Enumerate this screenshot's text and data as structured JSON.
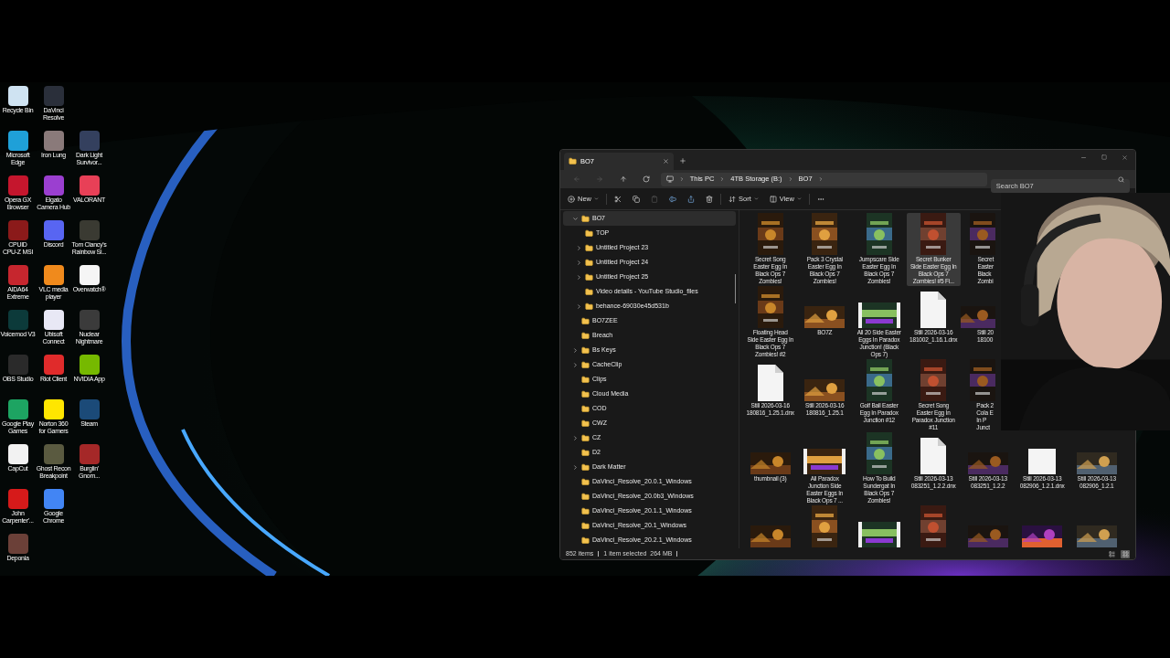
{
  "desktop_rows": [
    [
      {
        "label": "Recycle Bin",
        "color": "#cfe3f2"
      },
      {
        "label": "DaVinci\nResolve",
        "color": "#2a2f3a"
      }
    ],
    [
      {
        "label": "Microsoft\nEdge",
        "color": "#1fa0d8"
      },
      {
        "label": "Iron Lung",
        "color": "#8a7a7a"
      },
      {
        "label": "Dark Light\nSurvivor...",
        "color": "#34405e"
      }
    ],
    [
      {
        "label": "Opera GX\nBrowser",
        "color": "#c5162d"
      },
      {
        "label": "Elgato\nCamera Hub",
        "color": "#9b3fd0"
      },
      {
        "label": "VALORANT",
        "color": "#e84057"
      }
    ],
    [
      {
        "label": "CPUID\nCPU-Z MSI",
        "color": "#8b1a1a"
      },
      {
        "label": "Discord",
        "color": "#5865f2"
      },
      {
        "label": "Tom Clancy's\nRainbow Si...",
        "color": "#3a3a32"
      }
    ],
    [
      {
        "label": "AIDA64\nExtreme",
        "color": "#c6262e"
      },
      {
        "label": "VLC media\nplayer",
        "color": "#f08a1c"
      },
      {
        "label": "Overwatch®",
        "color": "#f5f5f5"
      }
    ],
    [
      {
        "label": "Voicemod V3",
        "color": "#0c3a3a"
      },
      {
        "label": "Ubisoft\nConnect",
        "color": "#e8e8f5"
      },
      {
        "label": "Nuclear\nNightmare",
        "color": "#3b3b3b"
      }
    ],
    [
      {
        "label": "OBS Studio",
        "color": "#2a2a2a"
      },
      {
        "label": "Riot Client",
        "color": "#e02b2b"
      },
      {
        "label": "NVIDIA App",
        "color": "#76b900"
      }
    ],
    [
      {
        "label": "Google Play\nGames",
        "color": "#1da462"
      },
      {
        "label": "Norton 360\nfor Gamers",
        "color": "#ffe600"
      },
      {
        "label": "Steam",
        "color": "#1b4a78"
      }
    ],
    [
      {
        "label": "CapCut",
        "color": "#f2f2f2"
      },
      {
        "label": "Ghost Recon\nBreakpoint",
        "color": "#5a5a40"
      },
      {
        "label": "Burglin'\nGnom...",
        "color": "#a52828"
      }
    ],
    [
      {
        "label": "John\nCarpenter'...",
        "color": "#d61a1a"
      },
      {
        "label": "Google\nChrome",
        "color": "#4285f4"
      }
    ],
    [
      {
        "label": "Deponia",
        "color": "#6b4038"
      }
    ]
  ],
  "explorer": {
    "tabs": [
      {
        "label": "BO7",
        "selected": true
      }
    ],
    "nav_buttons": [
      {
        "kind": "back",
        "disabled": true
      },
      {
        "kind": "forward",
        "disabled": true
      },
      {
        "kind": "up",
        "disabled": false
      },
      {
        "kind": "refresh",
        "disabled": false
      }
    ],
    "breadcrumb": [
      "This PC",
      "4TB Storage (B:)",
      "BO7"
    ],
    "search": {
      "placeholder": "Search BO7"
    },
    "toolbar": [
      {
        "kind": "new",
        "label": "New",
        "disabled": false
      },
      {
        "kind": "cut",
        "disabled": false
      },
      {
        "kind": "copy",
        "disabled": false
      },
      {
        "kind": "paste",
        "disabled": true
      },
      {
        "kind": "rename",
        "disabled": false
      },
      {
        "kind": "share",
        "disabled": false
      },
      {
        "kind": "delete",
        "disabled": false
      },
      {
        "kind": "sort",
        "label": "Sort",
        "disabled": false
      },
      {
        "kind": "view",
        "label": "View",
        "disabled": false
      },
      {
        "kind": "more",
        "disabled": false
      }
    ],
    "tree": [
      {
        "label": "BO7",
        "kind": "branch",
        "expanded": true,
        "selected": true,
        "children": [
          {
            "label": "TOP",
            "kind": "leaf",
            "selected": false
          },
          {
            "label": "Untitled Project 23",
            "kind": "branch",
            "expanded": false,
            "selected": false
          },
          {
            "label": "Untitled Project 24",
            "kind": "branch",
            "expanded": false,
            "selected": false
          },
          {
            "label": "Untitled Project 25",
            "kind": "branch",
            "expanded": false,
            "selected": false
          },
          {
            "label": "Video details - YouTube Studio_files",
            "kind": "leaf",
            "selected": false
          },
          {
            "label": "behance-69030e45d531b",
            "kind": "branch",
            "expanded": false,
            "selected": false
          }
        ]
      },
      {
        "label": "BO7ZEE",
        "kind": "leaf",
        "selected": false
      },
      {
        "label": "Breach",
        "kind": "leaf",
        "selected": false
      },
      {
        "label": "Bs Keys",
        "kind": "branch",
        "expanded": false,
        "selected": false
      },
      {
        "label": "CacheClip",
        "kind": "branch",
        "expanded": false,
        "selected": false
      },
      {
        "label": "Clips",
        "kind": "leaf",
        "selected": false
      },
      {
        "label": "Cloud Media",
        "kind": "leaf",
        "selected": false
      },
      {
        "label": "COD",
        "kind": "leaf",
        "selected": false
      },
      {
        "label": "CWZ",
        "kind": "leaf",
        "selected": false
      },
      {
        "label": "CZ",
        "kind": "branch",
        "expanded": false,
        "selected": false
      },
      {
        "label": "D2",
        "kind": "leaf",
        "selected": false
      },
      {
        "label": "Dark Matter",
        "kind": "branch",
        "expanded": false,
        "selected": false
      },
      {
        "label": "DaVinci_Resolve_20.0.1_Windows",
        "kind": "leaf",
        "selected": false
      },
      {
        "label": "DaVinci_Resolve_20.0b3_Windows",
        "kind": "leaf",
        "selected": false
      },
      {
        "label": "DaVinci_Resolve_20.1.1_Windows",
        "kind": "leaf",
        "selected": false
      },
      {
        "label": "DaVinci_Resolve_20.1_Windows",
        "kind": "leaf",
        "selected": false
      },
      {
        "label": "DaVinci_Resolve_20.2.1_Windows",
        "kind": "leaf",
        "selected": false
      }
    ],
    "items": [
      {
        "kind": "portrait",
        "label": "Secret Song\nEaster Egg In\nBlack Ops 7\nZombies!",
        "selected": false
      },
      {
        "kind": "portrait",
        "label": "Pack 3 Crystal\nEaster Egg In\nBlack Ops 7\nZombies!",
        "selected": false
      },
      {
        "kind": "portrait",
        "label": "Jumpscare Side\nEaster Egg In\nBlack Ops 7\nZombies!",
        "selected": false
      },
      {
        "kind": "portrait",
        "label": "Secret Bunker\nSide Easter Egg In\nBlack Ops 7\nZombies! #5 Fi...",
        "selected": true
      },
      {
        "kind": "portrait",
        "label": "Secret\nEaster\nBlack\nZombi",
        "selected": false
      },
      {
        "kind": "spacer"
      },
      {
        "kind": "spacer"
      },
      {
        "kind": "portrait",
        "label": "Floating Head\nSide Easter Egg In\nBlack Ops 7\nZombies! #2",
        "selected": false
      },
      {
        "kind": "landscape",
        "label": "BO7Z",
        "selected": false
      },
      {
        "kind": "filmstrip",
        "label": "All 20 Side Easter\nEggs In Paradox\nJunction! (Black\nOps 7)",
        "selected": false
      },
      {
        "kind": "document",
        "label": "Still 2026-03-16\n181002_1.16.1.dnx",
        "selected": false
      },
      {
        "kind": "landscape",
        "label": "Still 20\n18100",
        "selected": false
      },
      {
        "kind": "spacer"
      },
      {
        "kind": "spacer"
      },
      {
        "kind": "document",
        "label": "Still 2026-03-16\n180816_1.25.1.dnx",
        "selected": false
      },
      {
        "kind": "landscape",
        "label": "Still 2026-03-16\n180816_1.25.1",
        "selected": false
      },
      {
        "kind": "portrait",
        "label": "Golf Ball Easter\nEgg In Paradox\nJunction #12",
        "selected": false
      },
      {
        "kind": "portrait",
        "label": "Secret Song\nEaster Egg In\nParadox Junction\n#11",
        "selected": false
      },
      {
        "kind": "portrait",
        "label": "Pack 2\nCola E\nIn P\nJunct",
        "selected": false
      },
      {
        "kind": "spacer"
      },
      {
        "kind": "spacer"
      },
      {
        "kind": "landscape",
        "label": "thumbnail (3)",
        "selected": false
      },
      {
        "kind": "filmstrip",
        "label": "All Paradox\nJunction Side\nEaster Eggs In\nBlack Ops 7 ...",
        "selected": false
      },
      {
        "kind": "portrait",
        "label": "How To Build\nSundergat In\nBlack Ops 7\nZombies!",
        "selected": false
      },
      {
        "kind": "document",
        "label": "Still 2026-03-13\n083251_1.2.2.dnx",
        "selected": false
      },
      {
        "kind": "landscape",
        "label": "Still 2026-03-13\n083251_1.2.2",
        "selected": false
      },
      {
        "kind": "blank",
        "label": "Still 2026-03-13\n082906_1.2.1.dnx",
        "selected": false
      },
      {
        "kind": "landscape",
        "label": "Still 2026-03-13\n082906_1.2.1",
        "selected": false
      },
      {
        "kind": "landscape",
        "selected": false
      },
      {
        "kind": "portrait",
        "selected": false
      },
      {
        "kind": "filmstrip",
        "selected": false
      },
      {
        "kind": "portrait",
        "selected": false
      },
      {
        "kind": "landscape",
        "selected": false
      },
      {
        "kind": "landscape",
        "selected": false
      },
      {
        "kind": "landscape",
        "selected": false
      }
    ],
    "status": {
      "count": "852 items",
      "selection": "1 item selected  264 MB"
    },
    "view_modes": [
      {
        "kind": "details",
        "selected": false
      },
      {
        "kind": "tiles",
        "selected": true
      }
    ]
  }
}
